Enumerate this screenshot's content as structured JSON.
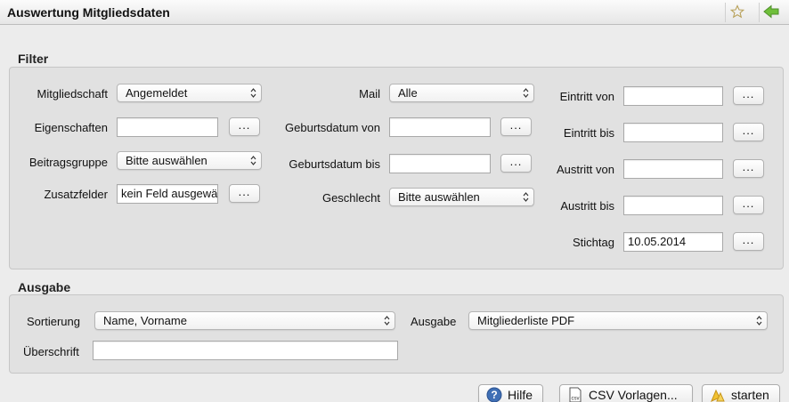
{
  "window": {
    "title": "Auswertung Mitgliedsdaten"
  },
  "filter": {
    "title": "Filter",
    "mitgliedschaft": {
      "label": "Mitgliedschaft",
      "value": "Angemeldet"
    },
    "eigenschaften": {
      "label": "Eigenschaften",
      "value": ""
    },
    "beitragsgruppe": {
      "label": "Beitragsgruppe",
      "value": "Bitte auswählen"
    },
    "zusatzfelder": {
      "label": "Zusatzfelder",
      "value": "kein Feld ausgewä"
    },
    "mail": {
      "label": "Mail",
      "value": "Alle"
    },
    "geburtsdatum_von": {
      "label": "Geburtsdatum von",
      "value": ""
    },
    "geburtsdatum_bis": {
      "label": "Geburtsdatum bis",
      "value": ""
    },
    "geschlecht": {
      "label": "Geschlecht",
      "value": "Bitte auswählen"
    },
    "eintritt_von": {
      "label": "Eintritt von",
      "value": ""
    },
    "eintritt_bis": {
      "label": "Eintritt bis",
      "value": ""
    },
    "austritt_von": {
      "label": "Austritt von",
      "value": ""
    },
    "austritt_bis": {
      "label": "Austritt bis",
      "value": ""
    },
    "stichtag": {
      "label": "Stichtag",
      "value": "10.05.2014"
    },
    "dots_label": "..."
  },
  "ausgabe": {
    "title": "Ausgabe",
    "sortierung": {
      "label": "Sortierung",
      "value": "Name, Vorname"
    },
    "ausgabe": {
      "label": "Ausgabe",
      "value": "Mitgliederliste PDF"
    },
    "ueberschrift": {
      "label": "Überschrift",
      "value": ""
    }
  },
  "buttons": {
    "hilfe": "Hilfe",
    "csv_vorlagen": "CSV Vorlagen...",
    "starten": "starten",
    "csv_icon_text": "csv"
  },
  "icons": {
    "star": "star-icon",
    "back": "back-arrow-icon",
    "help": "help-icon",
    "csv": "csv-file-icon",
    "start": "start-icon"
  },
  "colors": {
    "help_blue": "#3f6fb5",
    "back_green": "#6fbf3a",
    "start_yellow": "#f1c232"
  }
}
